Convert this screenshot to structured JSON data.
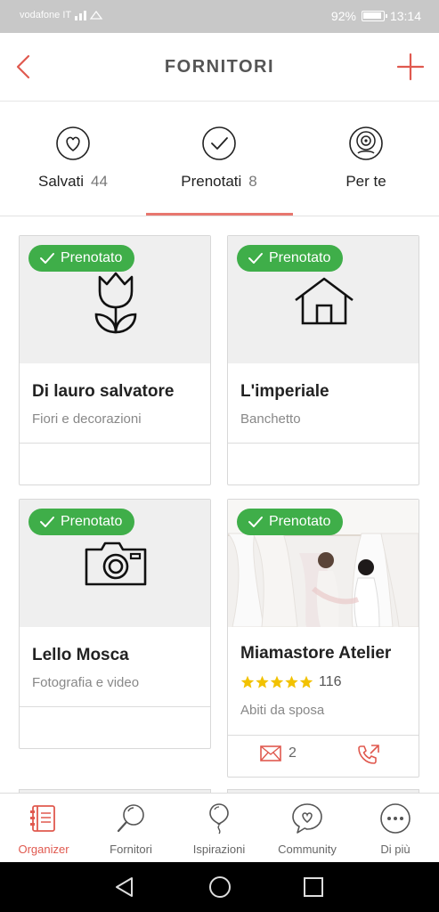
{
  "status_bar": {
    "carrier": "vodafone IT",
    "battery": "92%",
    "time": "13:14"
  },
  "header": {
    "title": "FORNITORI"
  },
  "tabs": [
    {
      "label": "Salvati",
      "count": "44",
      "icon": "heart-icon"
    },
    {
      "label": "Prenotati",
      "count": "8",
      "icon": "check-icon"
    },
    {
      "label": "Per te",
      "count": "",
      "icon": "target-icon"
    }
  ],
  "cards": [
    {
      "badge": "Prenotato",
      "name": "Di lauro salvatore",
      "category": "Fiori e decorazioni",
      "icon": "tulip-icon"
    },
    {
      "badge": "Prenotato",
      "name": "L'imperiale",
      "category": "Banchetto",
      "icon": "house-icon"
    },
    {
      "badge": "Prenotato",
      "name": "Lello Mosca",
      "category": "Fotografia e video",
      "icon": "camera-icon"
    },
    {
      "badge": "Prenotato",
      "name": "Miamastore Atelier",
      "category": "Abiti da sposa",
      "rating": 5,
      "reviews": "116",
      "messages": "2"
    }
  ],
  "bottom_nav": [
    {
      "label": "Organizer",
      "active": true
    },
    {
      "label": "Fornitori",
      "active": false
    },
    {
      "label": "Ispirazioni",
      "active": false
    },
    {
      "label": "Community",
      "active": false
    },
    {
      "label": "Di più",
      "active": false
    }
  ],
  "colors": {
    "accent": "#e0594f",
    "badge_green": "#3fae49",
    "star": "#f2c200"
  }
}
